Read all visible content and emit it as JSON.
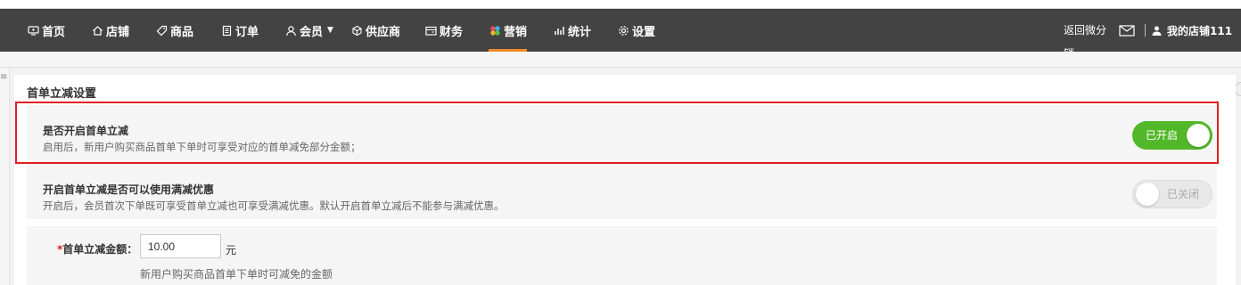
{
  "nav": {
    "items": [
      {
        "label": "首页",
        "icon": "home-screen-icon"
      },
      {
        "label": "店铺",
        "icon": "house-icon"
      },
      {
        "label": "商品",
        "icon": "tag-icon"
      },
      {
        "label": "订单",
        "icon": "document-icon"
      },
      {
        "label": "会员",
        "icon": "user-icon"
      },
      {
        "label": "供应商",
        "icon": "cube-icon"
      },
      {
        "label": "财务",
        "icon": "wallet-icon"
      },
      {
        "label": "营销",
        "icon": "petals-icon"
      },
      {
        "label": "统计",
        "icon": "bar-chart-icon"
      },
      {
        "label": "设置",
        "icon": "gear-icon"
      }
    ],
    "active": "营销",
    "back_label": "返回微分销",
    "shop_label": "我的店铺111"
  },
  "colors": {
    "nav_bg": "#434343",
    "active_underline": "#f08a24",
    "toggle_on": "#52b829",
    "highlight": "#e02020"
  },
  "page": {
    "section_title": "首单立减设置"
  },
  "settings": [
    {
      "title": "是否开启首单立减",
      "desc": "启用后，新用户购买商品首单下单时可享受对应的首单减免部分金额；",
      "toggle": "已开启",
      "enabled": true
    },
    {
      "title": "开启首单立减是否可以使用满减优惠",
      "desc": "开启后，会员首次下单既可享受首单立减也可享受满减优惠。默认开启首单立减后不能参与满减优惠。",
      "toggle": "已关闭",
      "enabled": false
    }
  ],
  "amount": {
    "required_mark": "*",
    "label": "首单立减金额：",
    "value": "10.00",
    "unit": "元",
    "hint": "新用户购买商品首单下单时可减免的金额"
  }
}
